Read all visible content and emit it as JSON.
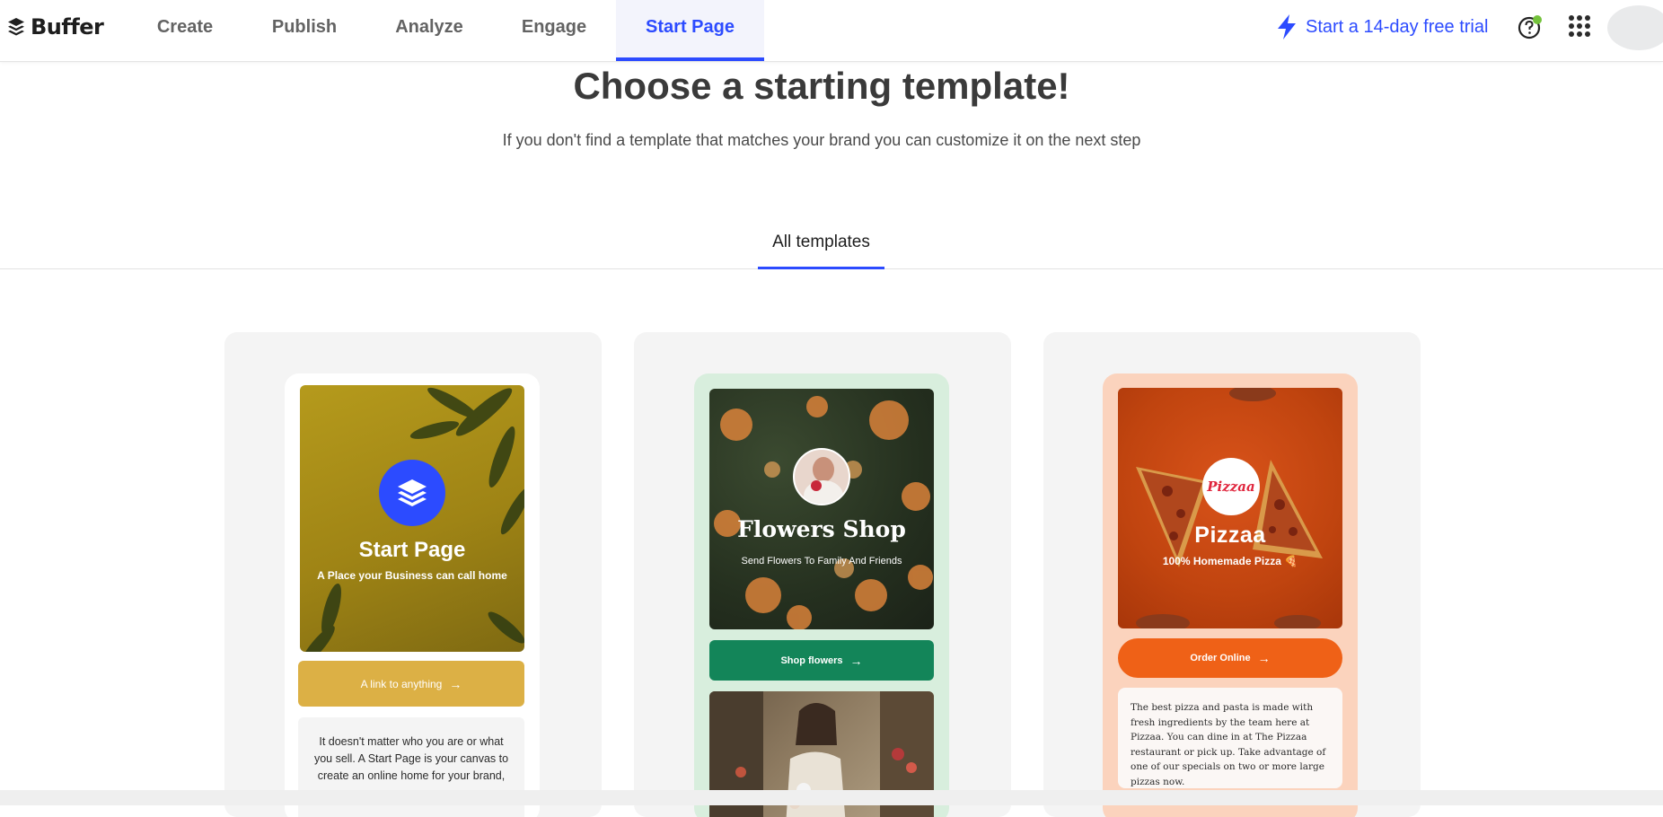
{
  "brand": {
    "name": "Buffer"
  },
  "nav": {
    "items": [
      {
        "label": "Create"
      },
      {
        "label": "Publish"
      },
      {
        "label": "Analyze"
      },
      {
        "label": "Engage"
      },
      {
        "label": "Start Page"
      }
    ],
    "active": "Start Page",
    "trial_label": "Start a 14-day free trial"
  },
  "icons": [
    "buffer-logo-icon",
    "lightning-icon",
    "help-icon",
    "apps-grid-icon",
    "avatar"
  ],
  "colors": {
    "accent": "#2c4bff",
    "flower_green": "#138559",
    "pizza_orange": "#ef6117",
    "start_gold": "#dcb045"
  },
  "page": {
    "title": "Choose a starting template!",
    "subtitle": "If you don't find a template that matches your brand you can customize it on the next step"
  },
  "tabs": [
    {
      "label": "All templates"
    }
  ],
  "templates": [
    {
      "hero_title": "Start Page",
      "hero_subtitle": "A Place your Business can call home",
      "button_label": "A link to anything",
      "body_text": "It doesn't matter who you are or what you sell. A Start Page is your canvas to create an online home for your brand,"
    },
    {
      "hero_title": "Flowers Shop",
      "hero_subtitle": "Send Flowers To Family And Friends",
      "button_label": "Shop flowers"
    },
    {
      "logo_text": "Pizzaa",
      "hero_title": "Pizzaa",
      "hero_subtitle": "100% Homemade Pizza 🍕",
      "button_label": "Order Online",
      "body_text": "The best pizza and pasta is made with fresh ingredients by the team here at Pizzaa. You can dine in at The Pizzaa restaurant or pick up. Take advantage of one of our specials on two or more large pizzas now."
    }
  ]
}
